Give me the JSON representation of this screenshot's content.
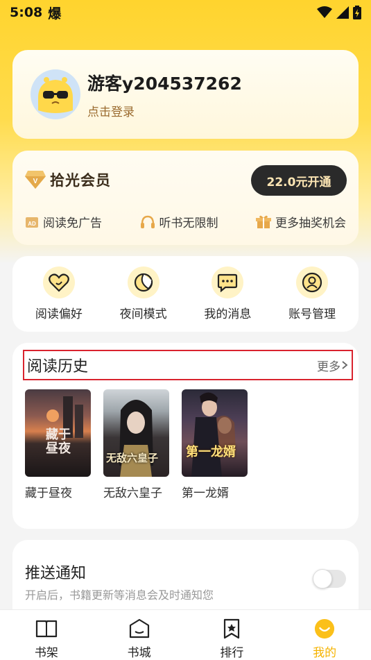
{
  "status_bar": {
    "time": "5:08",
    "extra": "爆"
  },
  "profile": {
    "username": "游客y204537262",
    "login_hint": "点击登录"
  },
  "vip": {
    "title": "拾光会员",
    "badge_letter": "V",
    "button_label": "22.0元开通",
    "benefits": [
      {
        "label": "阅读免广告",
        "icon": "ad-free-icon"
      },
      {
        "label": "听书无限制",
        "icon": "headphones-icon"
      },
      {
        "label": "更多抽奖机会",
        "icon": "gift-icon"
      }
    ]
  },
  "shortcuts": [
    {
      "label": "阅读偏好",
      "icon": "heart-icon"
    },
    {
      "label": "夜间模式",
      "icon": "moon-icon"
    },
    {
      "label": "我的消息",
      "icon": "message-icon"
    },
    {
      "label": "账号管理",
      "icon": "account-icon"
    }
  ],
  "history": {
    "title": "阅读历史",
    "more_label": "更多",
    "books": [
      {
        "title": "藏于昼夜",
        "cover_text": "藏于昼夜"
      },
      {
        "title": "无敌六皇子",
        "cover_text": "无敌六皇子"
      },
      {
        "title": "第一龙婿",
        "cover_text": "第一龙婿"
      }
    ]
  },
  "notification": {
    "title": "推送通知",
    "description": "开启后，书籍更新等消息会及时通知您",
    "enabled": false
  },
  "tabbar": {
    "tabs": [
      {
        "label": "书架",
        "icon": "bookshelf-icon"
      },
      {
        "label": "书城",
        "icon": "bookstore-icon"
      },
      {
        "label": "排行",
        "icon": "ranking-icon"
      },
      {
        "label": "我的",
        "icon": "profile-icon",
        "active": true
      }
    ]
  },
  "colors": {
    "accent": "#f5b300",
    "header_yellow": "#ffd42e",
    "vip_button": "#2a2a2a"
  }
}
